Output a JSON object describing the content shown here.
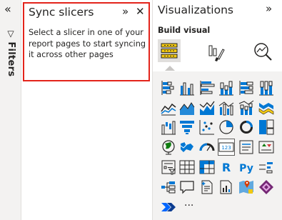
{
  "filters": {
    "collapse_glyph": "«",
    "label": "Filters"
  },
  "sync_slicers": {
    "title": "Sync slicers",
    "description": "Select a slicer in one of your report pages to start syncing it across other pages",
    "expand_glyph": "»",
    "close_glyph": "✕",
    "border_color": "#e3241b"
  },
  "visualizations": {
    "title": "Visualizations",
    "expand_glyph": "»",
    "subtitle": "Build visual",
    "more_label": "···",
    "accent_yellow": "#f2c811",
    "accent_blue": "#0078d4",
    "gallery": [
      "stacked-bar-chart",
      "clustered-column-chart",
      "clustered-bar-chart",
      "stacked-column-chart",
      "100-stacked-bar-chart",
      "100-stacked-column-chart",
      "line-chart",
      "area-chart",
      "stacked-area-chart",
      "line-clustered-column-chart",
      "line-stacked-column-chart",
      "ribbon-chart",
      "waterfall-chart",
      "funnel-chart",
      "scatter-chart",
      "pie-chart",
      "donut-chart",
      "treemap",
      "map",
      "filled-map",
      "gauge",
      "card",
      "multi-row-card",
      "kpi",
      "slicer",
      "table",
      "matrix",
      "r-script-visual",
      "python-visual",
      "key-influencers",
      "decomposition-tree",
      "qa-visual",
      "smart-narrative",
      "paginated-report",
      "azure-map",
      "power-apps",
      "power-automate"
    ]
  }
}
